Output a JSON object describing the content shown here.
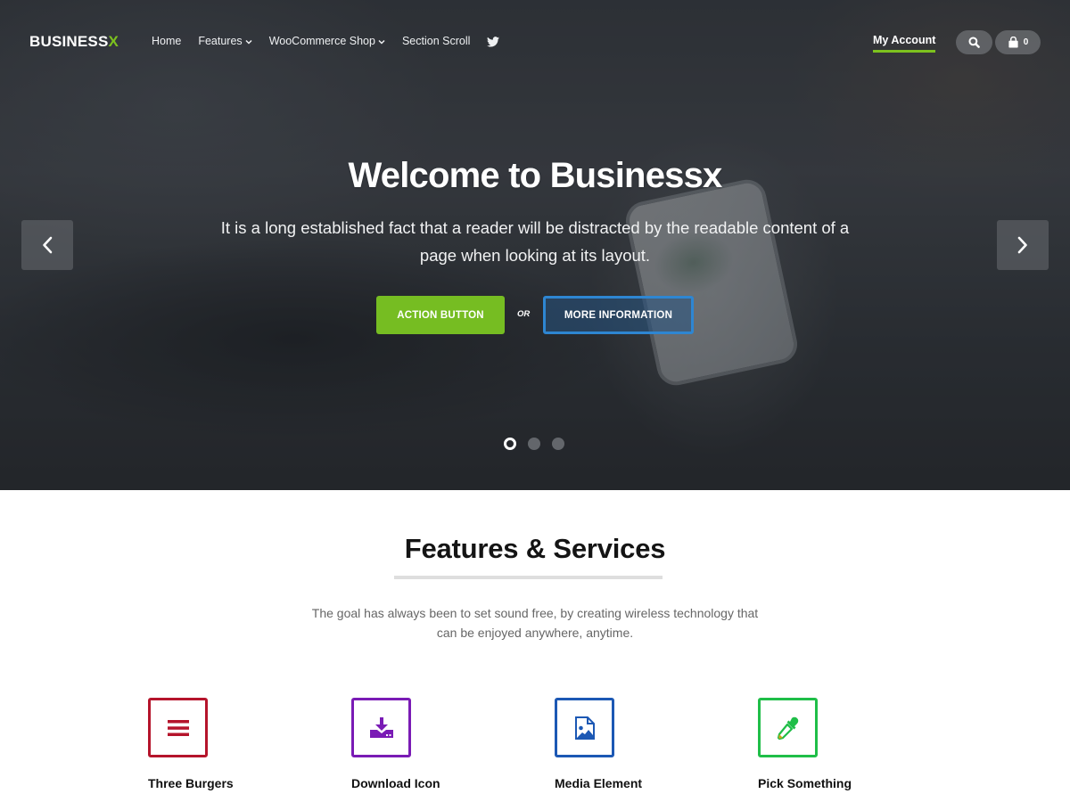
{
  "header": {
    "logo_main": "BUSINESS",
    "logo_accent": "X",
    "menu": [
      {
        "label": "Home",
        "has_dropdown": false
      },
      {
        "label": "Features",
        "has_dropdown": true
      },
      {
        "label": "WooCommerce Shop",
        "has_dropdown": true
      },
      {
        "label": "Section Scroll",
        "has_dropdown": false
      }
    ],
    "social_icon": "twitter-icon",
    "account_label": "My Account",
    "cart_count": "0"
  },
  "hero": {
    "title": "Welcome to Businessx",
    "subtitle": "It is a long established fact that a reader will be distracted by the readable content of a page when looking at its layout.",
    "primary_button": "ACTION BUTTON",
    "separator": "OR",
    "secondary_button": "MORE INFORMATION",
    "slides": 3,
    "active_slide": 1
  },
  "features": {
    "title": "Features & Services",
    "description": "The goal has always been to set sound free, by creating wireless technology that can be enjoyed anywhere, anytime.",
    "items": [
      {
        "label": "Three Burgers",
        "icon": "menu-icon",
        "color": "#b5142b"
      },
      {
        "label": "Download Icon",
        "icon": "download-icon",
        "color": "#7a1bb5"
      },
      {
        "label": "Media Element",
        "icon": "image-file-icon",
        "color": "#1c58b4"
      },
      {
        "label": "Pick Something",
        "icon": "eyedropper-icon",
        "color": "#1fbe48"
      }
    ]
  },
  "colors": {
    "accent_green": "#76bd22",
    "accent_blue": "#2e86d2"
  }
}
